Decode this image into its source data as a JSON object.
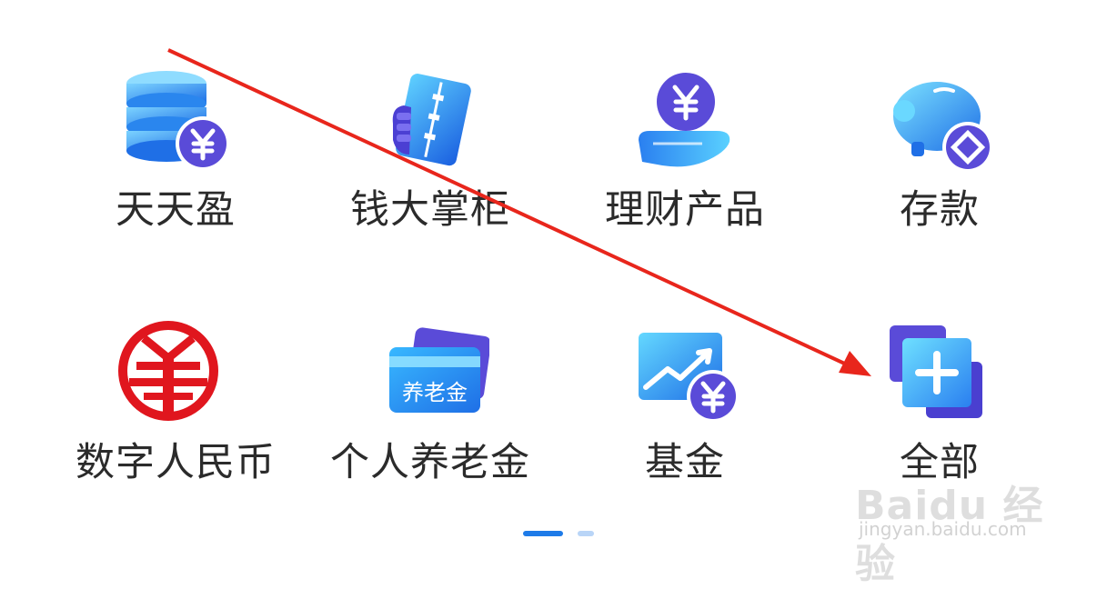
{
  "grid": {
    "items": [
      {
        "label": "天天盈",
        "icon": "coin-stack-yuan-icon"
      },
      {
        "label": "钱大掌柜",
        "icon": "abacus-card-icon"
      },
      {
        "label": "理财产品",
        "icon": "hand-holding-yuan-icon"
      },
      {
        "label": "存款",
        "icon": "piggy-bank-icon"
      },
      {
        "label": "数字人民币",
        "icon": "digital-rmb-icon"
      },
      {
        "label": "个人养老金",
        "icon": "pension-card-icon",
        "icon_text": "养老金"
      },
      {
        "label": "基金",
        "icon": "fund-chart-yuan-icon"
      },
      {
        "label": "全部",
        "icon": "all-plus-icon"
      }
    ]
  },
  "pager": {
    "pages": 2,
    "current": 1
  },
  "watermark": {
    "brand": "Baidu 经验",
    "url": "jingyan.baidu.com"
  },
  "colors": {
    "accent": "#1e7be8",
    "annotation_arrow": "#e8261c",
    "label": "#2b2b2b",
    "digital_rmb": "#e0161e",
    "purple": "#5b4bd9"
  }
}
